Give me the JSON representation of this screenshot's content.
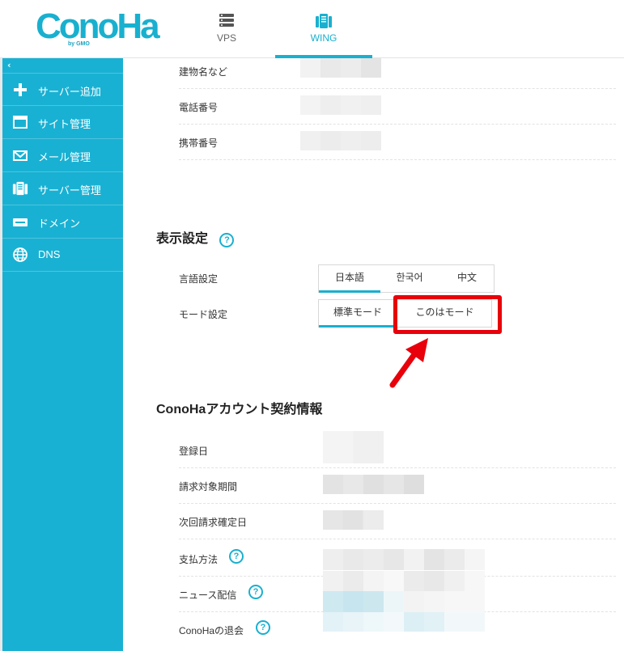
{
  "header": {
    "logo_text": "ConoHa",
    "logo_sub": "by GMO",
    "tabs": [
      {
        "label": "VPS",
        "icon": "server-stack-icon"
      },
      {
        "label": "WING",
        "icon": "wing-server-icon",
        "active": true
      }
    ]
  },
  "sidebar": {
    "collapse_glyph": "‹",
    "items": [
      {
        "label": "サーバー追加",
        "icon": "plus-icon"
      },
      {
        "label": "サイト管理",
        "icon": "window-icon"
      },
      {
        "label": "メール管理",
        "icon": "envelope-icon"
      },
      {
        "label": "サーバー管理",
        "icon": "server-icon"
      },
      {
        "label": "ドメイン",
        "icon": "domain-icon"
      },
      {
        "label": "DNS",
        "icon": "globe-icon"
      }
    ]
  },
  "address_rows": [
    {
      "label": "建物名など"
    },
    {
      "label": "電話番号"
    },
    {
      "label": "携帯番号"
    }
  ],
  "display_settings": {
    "title": "表示設定",
    "language": {
      "label": "言語設定",
      "options": [
        "日本語",
        "한국어",
        "中文"
      ],
      "selected": "日本語"
    },
    "mode": {
      "label": "モード設定",
      "options": [
        "標準モード",
        "このはモード"
      ],
      "selected": "標準モード"
    }
  },
  "account": {
    "title": "ConoHaアカウント契約情報",
    "rows": [
      {
        "label": "登録日",
        "help": false
      },
      {
        "label": "請求対象期間",
        "help": false
      },
      {
        "label": "次回請求確定日",
        "help": false
      },
      {
        "label": "支払方法",
        "help": true
      },
      {
        "label": "ニュース配信",
        "help": true
      },
      {
        "label": "ConoHaの退会",
        "help": true
      }
    ]
  },
  "help_glyph": "?",
  "colors": {
    "brand": "#19b0cf",
    "sidebar": "#19b1d3",
    "highlight": "#e8000b"
  }
}
